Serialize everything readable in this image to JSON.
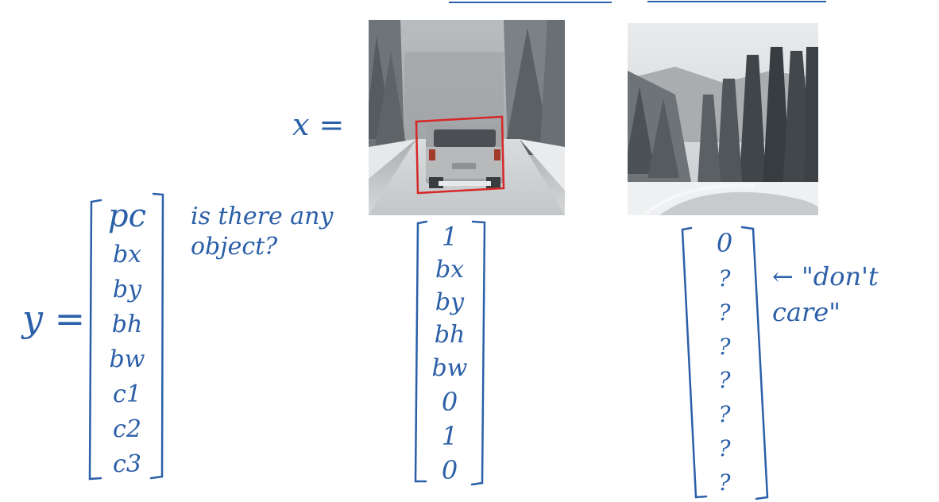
{
  "labels": {
    "x_eq": "x =",
    "y_eq": "y =",
    "question": "is there any\nobject?",
    "annotation": "← \"don't\ncare\""
  },
  "y_vector": [
    "pc",
    "bx",
    "by",
    "bh",
    "bw",
    "c1",
    "c2",
    "c3"
  ],
  "car_vector": [
    "1",
    "bx",
    "by",
    "bh",
    "bw",
    "0",
    "1",
    "0"
  ],
  "empty_vector": [
    "0",
    "?",
    "?",
    "?",
    "?",
    "?",
    "?",
    "?"
  ],
  "colors": {
    "ink": "#2b5fa8",
    "bbox": "#d62828"
  }
}
